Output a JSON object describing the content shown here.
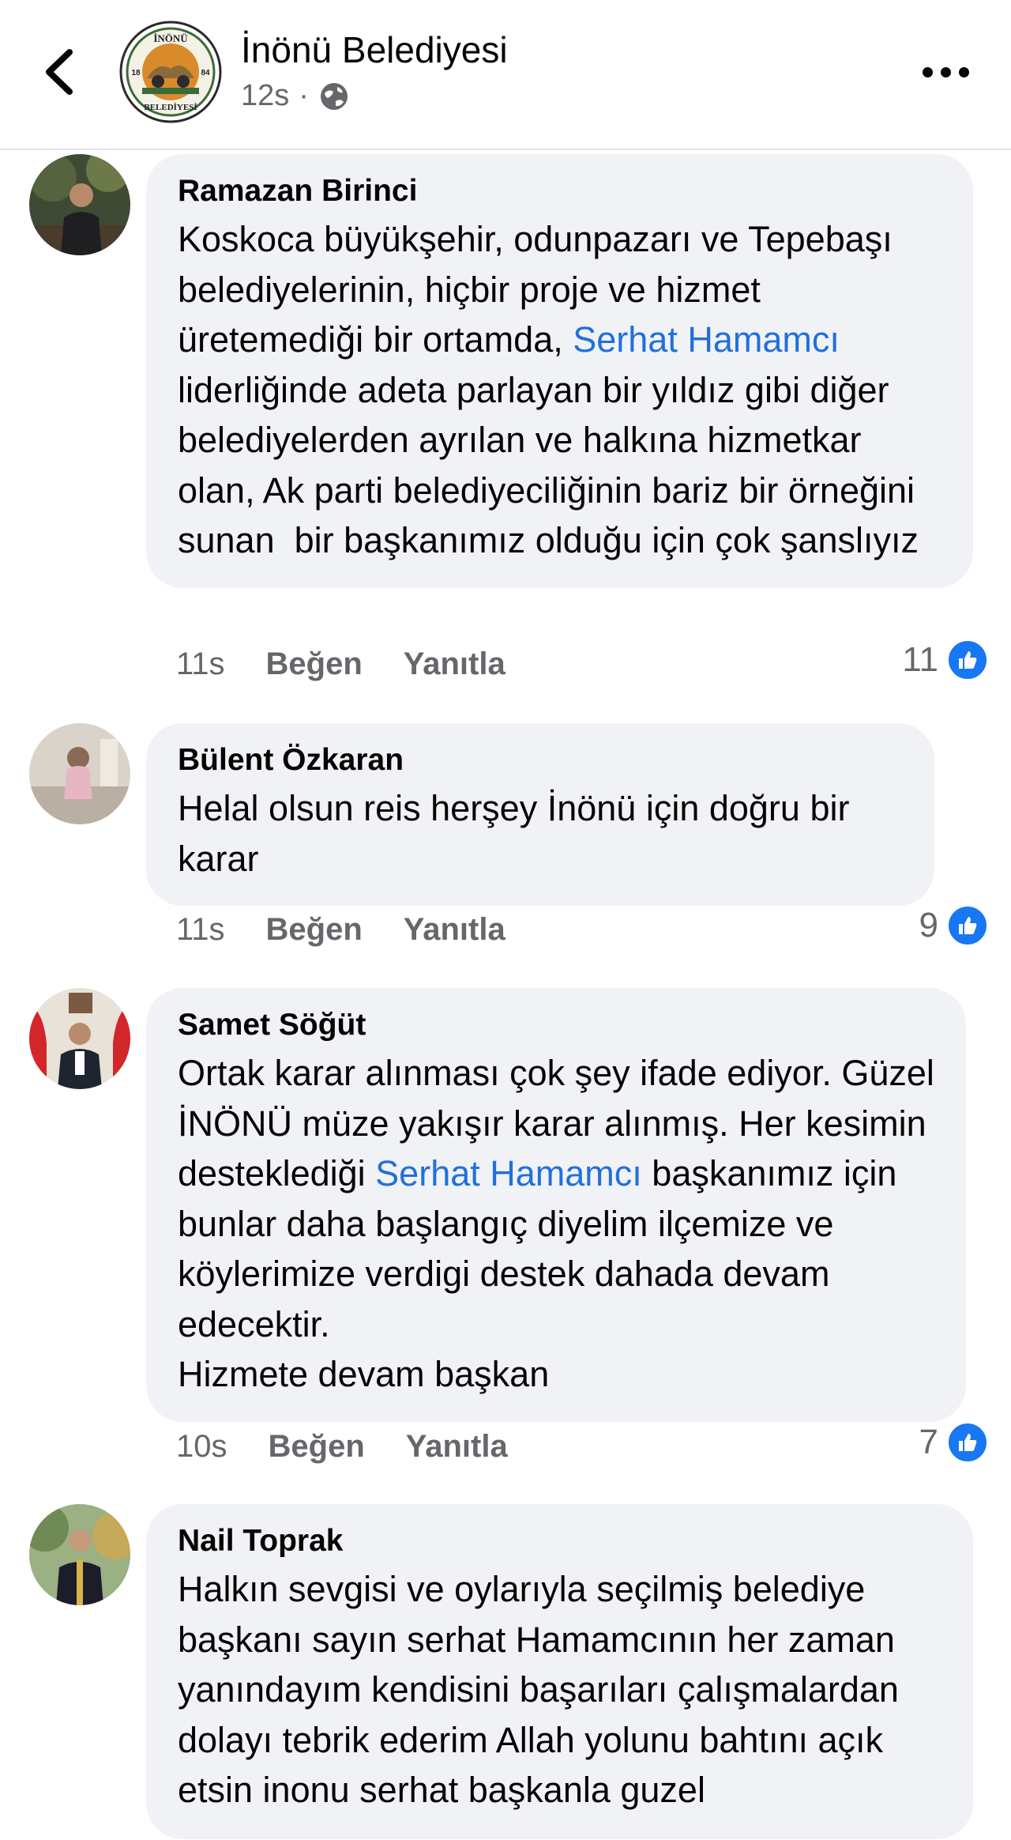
{
  "header": {
    "page_name": "İnönü Belediyesi",
    "time": "12s",
    "separator": "·",
    "logo_text_top": "İNÖNÜ",
    "logo_text_bottom": "BELEDİYESİ",
    "logo_year_left": "18",
    "logo_year_right": "84"
  },
  "comments": [
    {
      "author": "Ramazan Birinci",
      "text_before": "Koskoca büyükşehir, odunpazarı ve Tepebaşı belediyelerinin, hiçbir proje ve hizmet üretemediği bir ortamda, ",
      "mention": "Serhat Hamamcı",
      "text_after": " liderliğinde adeta parlayan bir yıldız gibi diğer belediyelerden ayrılan ve halkına hizmetkar olan, Ak parti belediyeciliğinin bariz bir örneğini sunan  bir başkanımız olduğu için çok şanslıyız",
      "time": "11s",
      "like_label": "Beğen",
      "reply_label": "Yanıtla",
      "reactions": "11"
    },
    {
      "author": "Bülent Özkaran",
      "text_before": "Helal olsun reis herşey İnönü için doğru bir karar",
      "mention": "",
      "text_after": "",
      "time": "11s",
      "like_label": "Beğen",
      "reply_label": "Yanıtla",
      "reactions": "9"
    },
    {
      "author": "Samet Söğüt",
      "text_before": "Ortak karar alınması çok şey ifade ediyor. Güzel İNÖNÜ müze yakışır karar alınmış. Her kesimin desteklediği ",
      "mention": "Serhat Hamamcı",
      "text_after": " başkanımız için bunlar daha başlangıç diyelim ilçemize ve köylerimize verdigi destek dahada devam edecektir.\nHizmete devam başkan",
      "time": "10s",
      "like_label": "Beğen",
      "reply_label": "Yanıtla",
      "reactions": "7"
    },
    {
      "author": "Nail Toprak",
      "text_before": "Halkın sevgisi ve oylarıyla seçilmiş belediye başkanı sayın serhat Hamamcının her zaman yanındayım kendisini başarıları çalışmalardan dolayı tebrik ederim Allah yolunu bahtını açık etsin inonu serhat başkanla guzel",
      "mention": "",
      "text_after": "",
      "time": "",
      "like_label": "",
      "reply_label": "",
      "reactions": ""
    }
  ],
  "colors": {
    "mention": "#216fdb",
    "bubble": "#f0f2f5",
    "like": "#1877f2",
    "meta": "#65676b"
  },
  "icons": {
    "back": "chevron-left-icon",
    "privacy": "globe-icon",
    "more": "more-dots-icon",
    "reaction": "like-icon"
  }
}
